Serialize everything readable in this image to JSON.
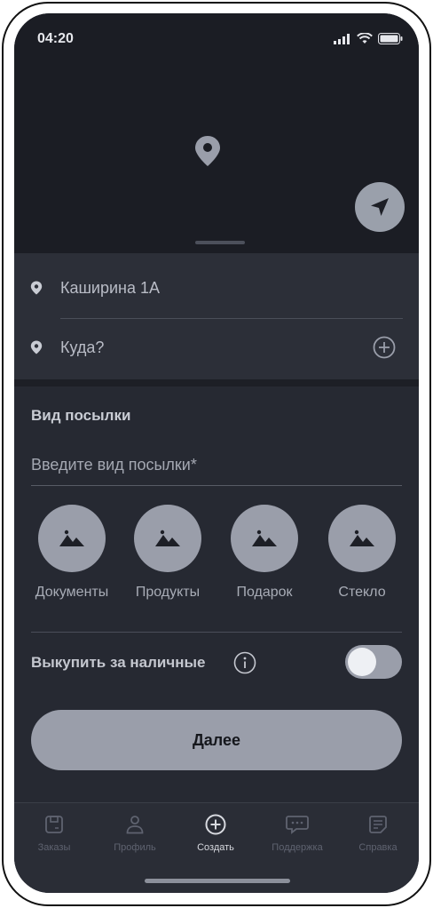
{
  "status": {
    "time": "04:20"
  },
  "addresses": {
    "from": "Каширина 1А",
    "to_placeholder": "Куда?"
  },
  "parcel": {
    "section_title": "Вид посылки",
    "input_placeholder": "Введите вид посылки*",
    "categories": [
      {
        "label": "Документы",
        "icon": "image-icon"
      },
      {
        "label": "Продукты",
        "icon": "image-icon"
      },
      {
        "label": "Подарок",
        "icon": "image-icon"
      },
      {
        "label": "Стекло",
        "icon": "image-icon"
      }
    ]
  },
  "cash": {
    "label": "Выкупить за наличные",
    "enabled": false
  },
  "next_button": {
    "label": "Далее"
  },
  "tabbar": {
    "tabs": [
      {
        "label": "Заказы",
        "icon": "orders-icon",
        "active": false
      },
      {
        "label": "Профиль",
        "icon": "profile-icon",
        "active": false
      },
      {
        "label": "Создать",
        "icon": "create-icon",
        "active": true
      },
      {
        "label": "Поддержка",
        "icon": "support-icon",
        "active": false
      },
      {
        "label": "Справка",
        "icon": "help-icon",
        "active": false
      }
    ]
  },
  "colors": {
    "background": "#262932",
    "map": "#1b1d24",
    "accent_muted": "#9a9eaa",
    "text_primary": "#c9ccd4"
  }
}
